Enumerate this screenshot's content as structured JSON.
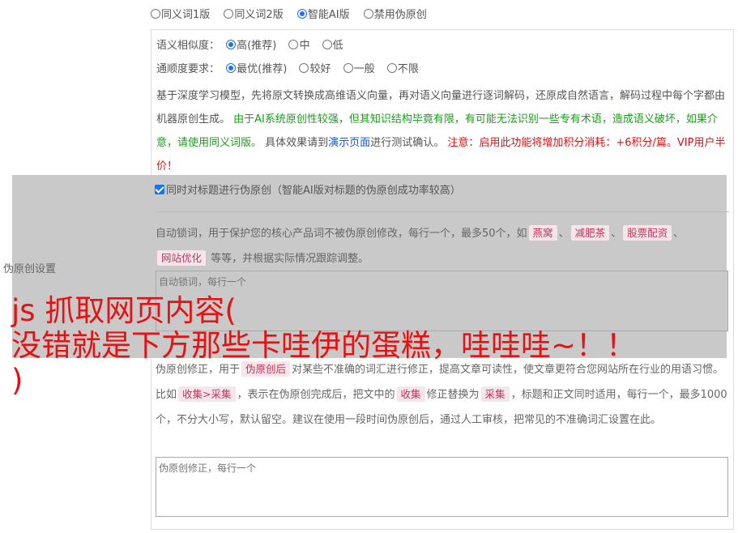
{
  "version_options": [
    {
      "label": "同义词1版",
      "selected": false
    },
    {
      "label": "同义词2版",
      "selected": false
    },
    {
      "label": "智能AI版",
      "selected": true
    },
    {
      "label": "禁用伪原创",
      "selected": false
    }
  ],
  "similarity": {
    "label": "语义相似度：",
    "options": [
      {
        "label": "高(推荐)",
        "selected": true
      },
      {
        "label": "中",
        "selected": false
      },
      {
        "label": "低",
        "selected": false
      }
    ]
  },
  "fluency": {
    "label": "通顺度要求：",
    "options": [
      {
        "label": "最优(推荐)",
        "selected": true
      },
      {
        "label": "较好",
        "selected": false
      },
      {
        "label": "一般",
        "selected": false
      },
      {
        "label": "不限",
        "selected": false
      }
    ]
  },
  "description": {
    "intro": "基于深度学习模型，先将原文转换成高维语义向量，再对语义向量进行逐词解码，还原成自然语言，解码过程中每个字都由机器原创生成。",
    "warning_green": "由于AI系统原创性较强，但其知识结构毕竟有限，有可能无法识别一些专有术语，造成语义破坏，如果介意，请使用同义词版。",
    "test_prefix": "具体效果请到",
    "test_link": "演示页面",
    "test_suffix": "进行测试确认。",
    "cost_red": "注意：启用此功能将增加积分消耗：+6积分/篇。VIP用户半价！"
  },
  "title_check": {
    "label": "同时对标题进行伪原创（智能AI版对标题的伪原创成功率较高）",
    "checked": true
  },
  "lock_words": {
    "text_before": "自动锁词，用于保护您的核心产品词不被伪原创修改，每行一个，最多50个，如",
    "examples": [
      "燕窝",
      "减肥茶",
      "股票配资",
      "网站优化"
    ],
    "text_after": "等等，并根据实际情况跟踪调整。",
    "placeholder": "自动锁词，每行一个"
  },
  "side_label": "伪原创设置",
  "correction": {
    "text1": "伪原创修正，用于",
    "tag1": "伪原创后",
    "text2": "对某些不准确的词汇进行修正，提高文章可读性，使文章更符合您网站所在行业的用语习惯。比如",
    "tag2": "收集>采集",
    "text3": "，表示在伪原创完成后，把文中的",
    "tag3": "收集",
    "text4": "修正替换为",
    "tag4": "采集",
    "text5": "，标题和正文同时适用，每行一个，最多1000个，不分大小写，默认留空。建议在使用一段时间伪原创后，通过人工审核，把常见的不准确词汇设置在此。",
    "placeholder": "伪原创修正，每行一个"
  },
  "banner": {
    "line1": "js 抓取网页内容(",
    "line2": "没错就是下方那些卡哇伊的蛋糕，哇哇哇~！！",
    "line3": ")"
  }
}
